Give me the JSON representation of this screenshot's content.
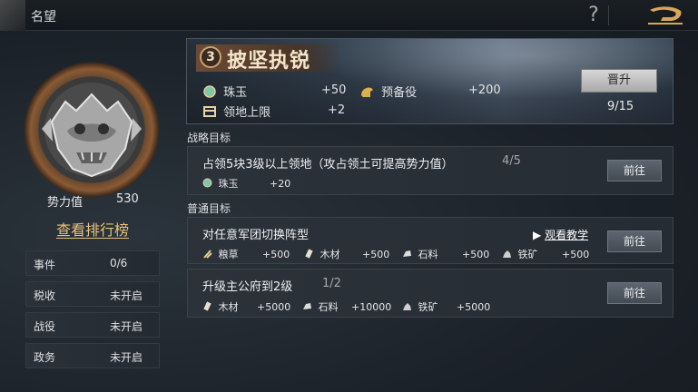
{
  "header": {
    "title": "名望"
  },
  "left": {
    "power_label": "势力值",
    "power_value": "530",
    "rank_link": "查看排行榜",
    "rows": [
      {
        "label": "事件",
        "value": "0/6"
      },
      {
        "label": "税收",
        "value": "未开启"
      },
      {
        "label": "战役",
        "value": "未开启"
      },
      {
        "label": "政务",
        "value": "未开启"
      }
    ]
  },
  "banner": {
    "rank_number": "3",
    "rank_title": "披坚执锐",
    "rewards": [
      {
        "icon": "jade-orb-icon",
        "label": "珠玉",
        "value": "+50"
      },
      {
        "icon": "reserve-helmet-icon",
        "label": "预备役",
        "value": "+200"
      },
      {
        "icon": "territory-icon",
        "label": "领地上限",
        "value": "+2"
      }
    ],
    "promote_label": "晋升",
    "progress": "9/15"
  },
  "strategic": {
    "section_label": "战略目标",
    "task": {
      "name": "占领5块3级以上领地（攻占领土可提高势力值）",
      "progress": "4/5",
      "reward_label": "珠玉",
      "reward_value": "+20",
      "go_label": "前往"
    }
  },
  "normal": {
    "section_label": "普通目标",
    "tasks": [
      {
        "name": "对任意军团切换阵型",
        "tutorial": "观看教学",
        "rewards": [
          {
            "icon": "grain-icon",
            "label": "粮草",
            "value": "+500"
          },
          {
            "icon": "wood-icon",
            "label": "木材",
            "value": "+500"
          },
          {
            "icon": "stone-icon",
            "label": "石料",
            "value": "+500"
          },
          {
            "icon": "iron-ore-icon",
            "label": "铁矿",
            "value": "+500"
          }
        ],
        "go_label": "前往"
      },
      {
        "name": "升级主公府到2级",
        "progress": "1/2",
        "rewards": [
          {
            "icon": "wood-icon",
            "label": "木材",
            "value": "+5000"
          },
          {
            "icon": "stone-icon",
            "label": "石料",
            "value": "+10000"
          },
          {
            "icon": "iron-ore-icon",
            "label": "铁矿",
            "value": "+5000"
          }
        ],
        "go_label": "前往"
      }
    ]
  }
}
